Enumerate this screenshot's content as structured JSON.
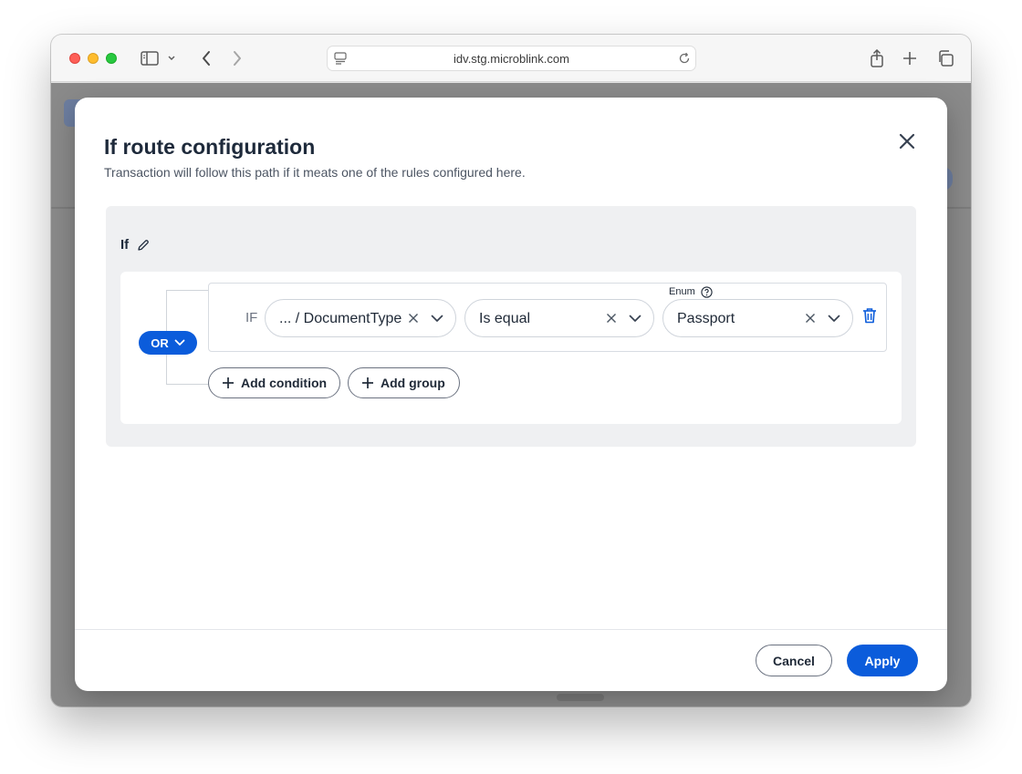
{
  "browser": {
    "url": "idv.stg.microblink.com",
    "icons": {
      "sidebar": "sidebar-icon",
      "back": "chevron-left-icon",
      "forward": "chevron-right-icon",
      "share": "share-icon",
      "new_tab": "plus-icon",
      "tabs": "tabs-overview-icon",
      "reload": "reload-icon"
    }
  },
  "modal": {
    "title": "If route configuration",
    "subtitle": "Transaction will follow this path if it meats one of the rules configured here.",
    "panel_label": "If",
    "operator": "OR",
    "condition": {
      "if_word": "IF",
      "field": "... / DocumentType",
      "comparator": "Is equal",
      "value_label": "Enum",
      "value": "Passport"
    },
    "add_condition_label": "Add condition",
    "add_group_label": "Add group",
    "cancel_label": "Cancel",
    "apply_label": "Apply"
  },
  "colors": {
    "accent": "#0b5cdb",
    "title_text": "#1e2a3b",
    "panel_bg": "#eff0f2"
  }
}
